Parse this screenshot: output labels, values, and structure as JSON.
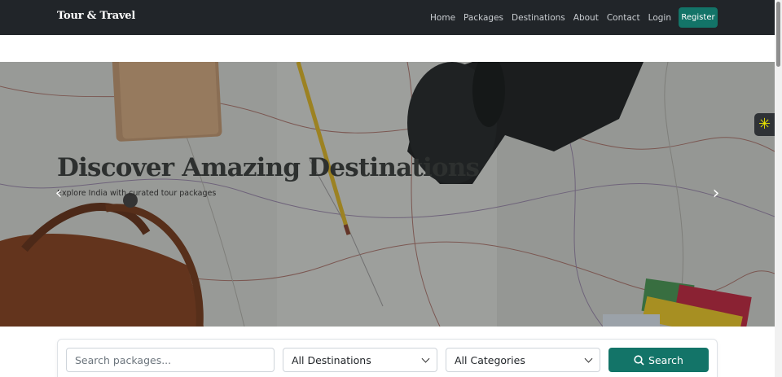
{
  "navbar": {
    "brand": "Tour & Travel",
    "links": [
      "Home",
      "Packages",
      "Destinations",
      "About",
      "Contact",
      "Login"
    ],
    "register_label": "Register"
  },
  "hero": {
    "title": "Discover Amazing Destinations",
    "subtitle": "Explore India with curated tour packages",
    "prev_icon": "chevron-left-icon",
    "next_icon": "chevron-right-icon"
  },
  "search": {
    "placeholder": "Search packages...",
    "destination_selected": "All Destinations",
    "category_selected": "All Categories",
    "button_label": "Search"
  },
  "colors": {
    "navbar_bg": "#212529",
    "accent": "#137468"
  }
}
